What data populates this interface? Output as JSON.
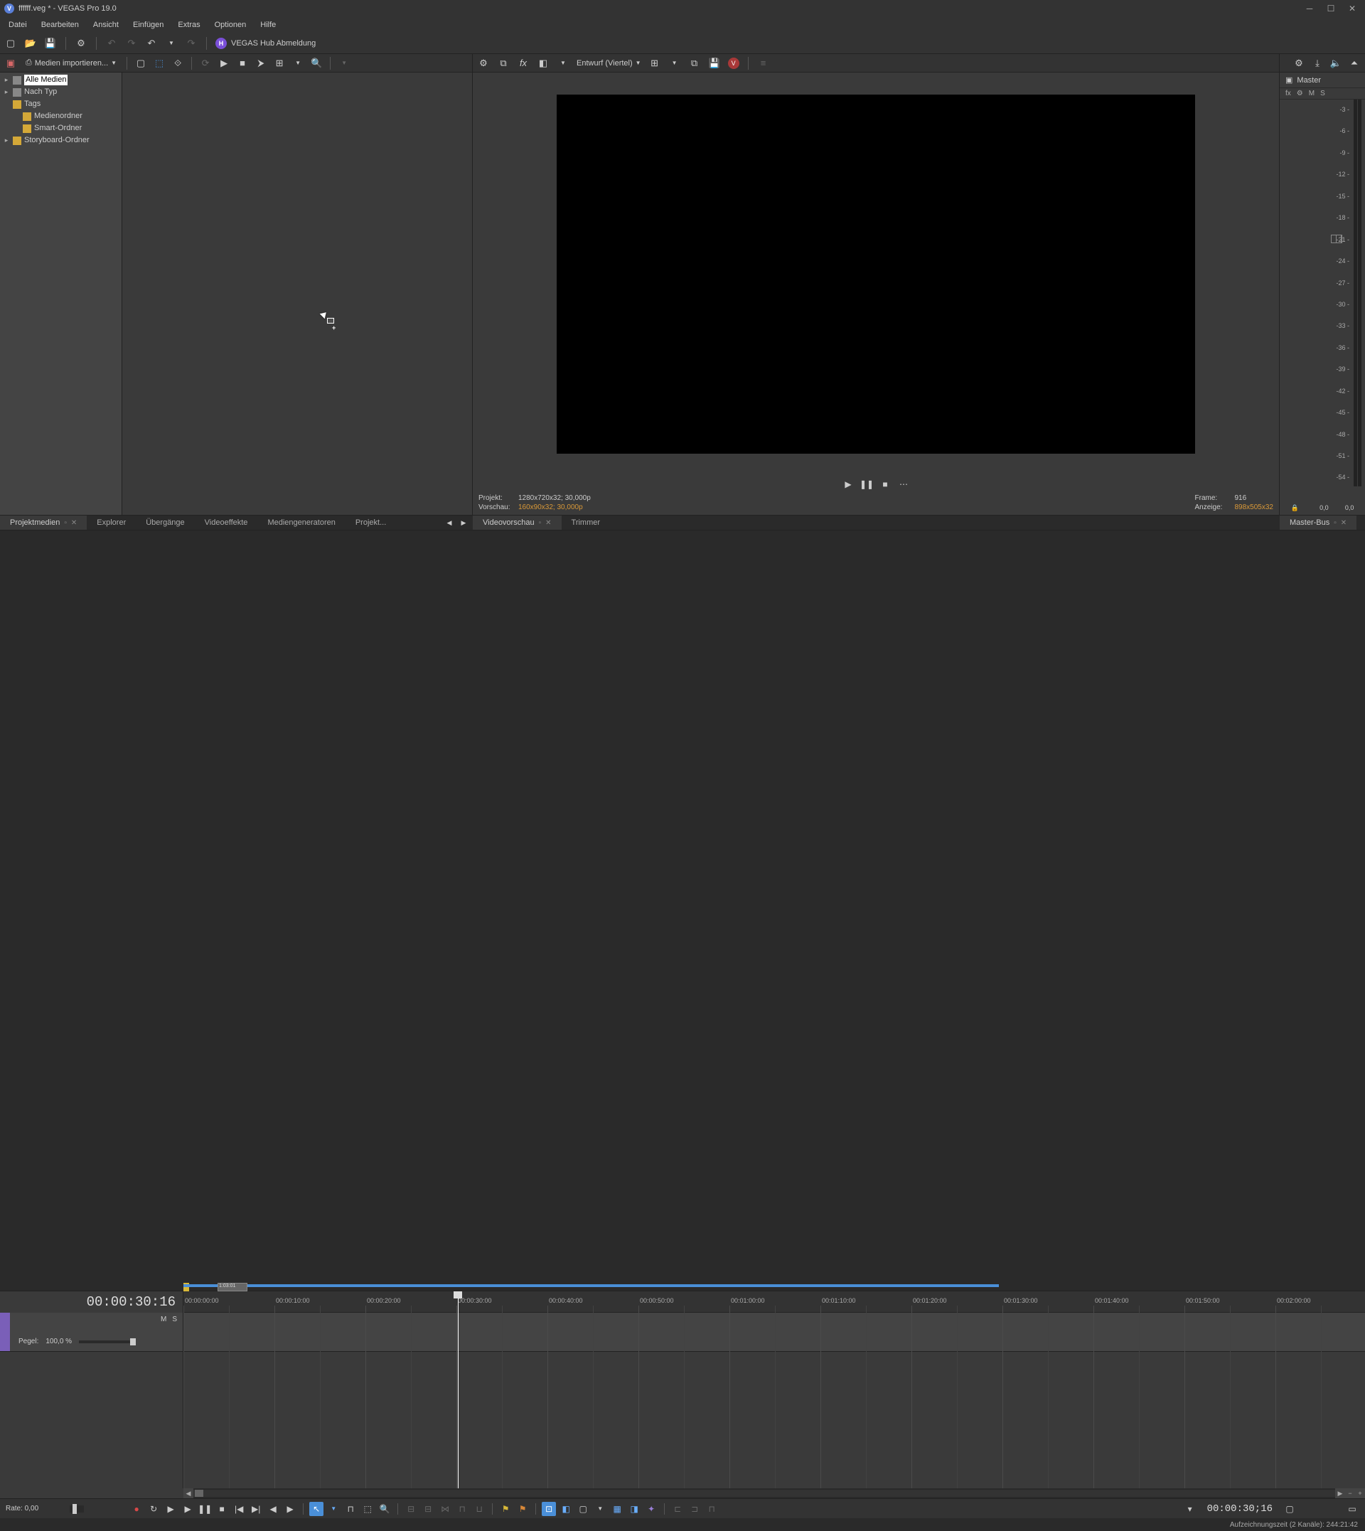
{
  "app": {
    "title": "ffffff.veg * - VEGAS Pro 19.0",
    "icon_letter": "V"
  },
  "menu": [
    "Datei",
    "Bearbeiten",
    "Ansicht",
    "Einfügen",
    "Extras",
    "Optionen",
    "Hilfe"
  ],
  "hub": {
    "label": "VEGAS Hub Abmeldung",
    "icon": "H"
  },
  "media_panel": {
    "import_label": "Medien importieren...",
    "tree": [
      {
        "label": "Alle Medien",
        "icon": "media",
        "expandable": true,
        "selected": true,
        "child": false
      },
      {
        "label": "Nach Typ",
        "icon": "media",
        "expandable": true,
        "selected": false,
        "child": false
      },
      {
        "label": "Tags",
        "icon": "folder",
        "expandable": false,
        "selected": false,
        "child": false
      },
      {
        "label": "Medienordner",
        "icon": "folder",
        "expandable": false,
        "selected": false,
        "child": true
      },
      {
        "label": "Smart-Ordner",
        "icon": "folder",
        "expandable": false,
        "selected": false,
        "child": true
      },
      {
        "label": "Storyboard-Ordner",
        "icon": "folder",
        "expandable": true,
        "selected": false,
        "child": false
      }
    ]
  },
  "preview": {
    "quality_label": "Entwurf (Viertel)",
    "info": {
      "projekt_label": "Projekt:",
      "projekt_val": "1280x720x32; 30,000p",
      "vorschau_label": "Vorschau:",
      "vorschau_val": "160x90x32; 30,000p",
      "frame_label": "Frame:",
      "frame_val": "916",
      "anzeige_label": "Anzeige:",
      "anzeige_val": "898x505x32"
    }
  },
  "tabs": {
    "left": [
      {
        "label": "Projektmedien",
        "active": true,
        "closable": true
      },
      {
        "label": "Explorer",
        "active": false,
        "closable": false
      },
      {
        "label": "Übergänge",
        "active": false,
        "closable": false
      },
      {
        "label": "Videoeffekte",
        "active": false,
        "closable": false
      },
      {
        "label": "Mediengeneratoren",
        "active": false,
        "closable": false
      },
      {
        "label": "Projekt...",
        "active": false,
        "closable": false
      }
    ],
    "mid": [
      {
        "label": "Videovorschau",
        "active": true,
        "closable": true
      },
      {
        "label": "Trimmer",
        "active": false,
        "closable": false
      }
    ],
    "right": [
      {
        "label": "Master-Bus",
        "active": true,
        "closable": true
      }
    ]
  },
  "master": {
    "label": "Master",
    "sub": [
      "fx",
      "⚙",
      "M",
      "S"
    ],
    "ticks": [
      "-3",
      "-6",
      "-9",
      "-12",
      "-15",
      "-18",
      "-21",
      "-24",
      "-27",
      "-30",
      "-33",
      "-36",
      "-39",
      "-42",
      "-45",
      "-48",
      "-51",
      "-54",
      ""
    ],
    "footer": [
      "0,0",
      "0,0"
    ]
  },
  "timeline": {
    "cursor_time": "00:00:30:16",
    "marker_label": "1:03:01",
    "ruler": [
      "00:00:00:00",
      "00:00:10:00",
      "00:00:20:00",
      "00:00:30:00",
      "00:00:40:00",
      "00:00:50:00",
      "00:01:00:00",
      "00:01:10:00",
      "00:01:20:00",
      "00:01:30:00",
      "00:01:40:00",
      "00:01:50:00",
      "00:02:00:00"
    ],
    "track": {
      "ms": [
        "M",
        "S"
      ],
      "level_label": "Pegel:",
      "level_val": "100,0 %"
    }
  },
  "transport": {
    "rate_label": "Rate: 0,00",
    "time": "00:00:30;16"
  },
  "status": {
    "text": "Aufzeichnungszeit (2 Kanäle): 244:21:42"
  }
}
